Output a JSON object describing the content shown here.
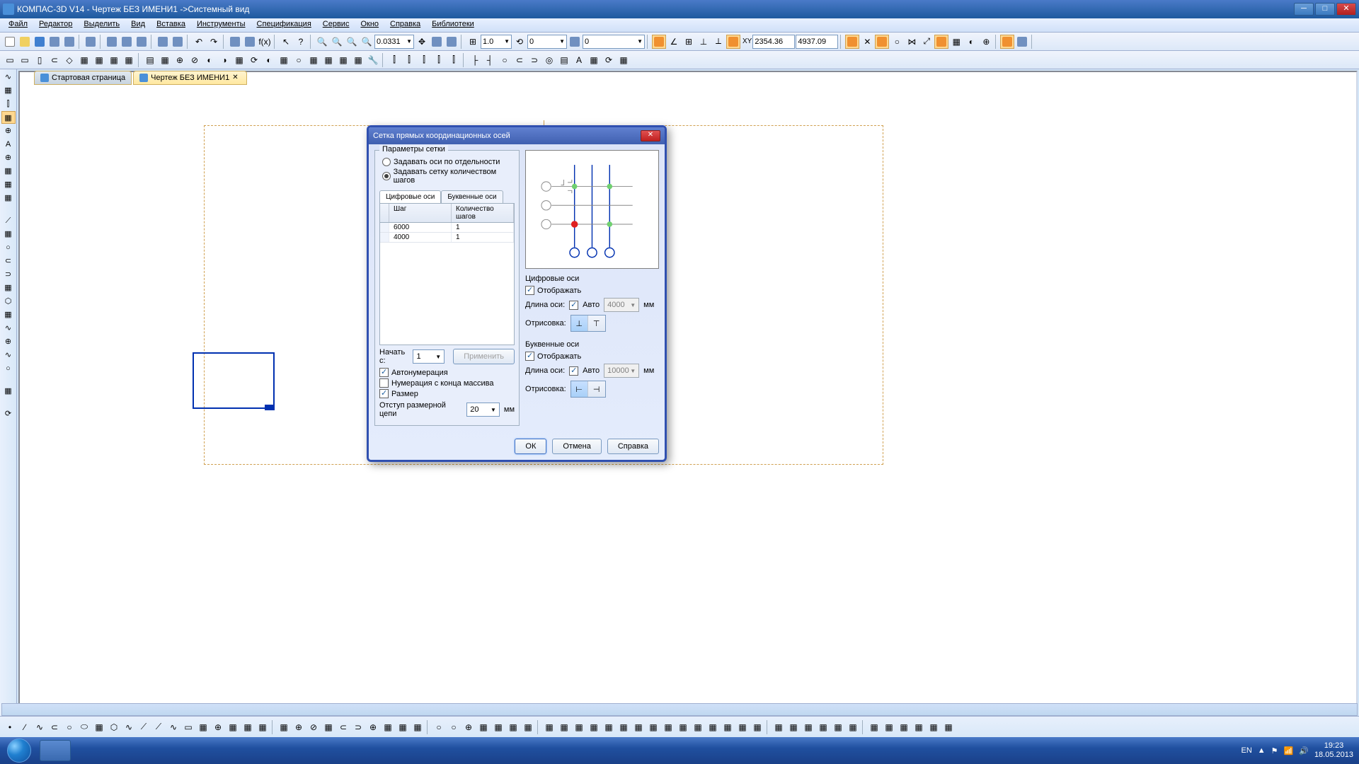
{
  "app": {
    "title": "КОМПАС-3D V14 - Чертеж БЕЗ ИМЕНИ1 ->Системный вид"
  },
  "menu": {
    "items": [
      "Файл",
      "Редактор",
      "Выделить",
      "Вид",
      "Вставка",
      "Инструменты",
      "Спецификация",
      "Сервис",
      "Окно",
      "Справка",
      "Библиотеки"
    ]
  },
  "toolbar1": {
    "zoom_value": "0.0331",
    "scale_value": "1.0",
    "coord1": "0",
    "coord2": "0",
    "x_val": "2354.36",
    "y_val": "4937.09"
  },
  "tabs": {
    "start": "Стартовая страница",
    "doc": "Чертеж БЕЗ ИМЕНИ1"
  },
  "dialog": {
    "title": "Сетка прямых координационных осей",
    "group_title": "Параметры сетки",
    "radio1": "Задавать оси по отдельности",
    "radio2": "Задавать сетку количеством шагов",
    "tab_digital": "Цифровые оси",
    "tab_letter": "Буквенные оси",
    "col_step": "Шаг",
    "col_count": "Количество шагов",
    "rows": [
      {
        "step": "6000",
        "count": "1"
      },
      {
        "step": "4000",
        "count": "1"
      }
    ],
    "start_from": "Начать с:",
    "start_value": "1",
    "apply": "Применить",
    "chk_autonum": "Автонумерация",
    "chk_endnum": "Нумерация с конца массива",
    "chk_size": "Размер",
    "dim_offset": "Отступ размерной цепи",
    "dim_offset_val": "20",
    "mm": "мм",
    "digital_axes": "Цифровые оси",
    "letter_axes": "Буквенные оси",
    "show": "Отображать",
    "axis_len": "Длина оси:",
    "auto": "Авто",
    "len_digital": "4000",
    "len_letter": "10000",
    "rendering": "Отрисовка:",
    "ok": "ОК",
    "cancel": "Отмена",
    "help": "Справка"
  },
  "tray": {
    "lang": "EN",
    "time": "19:23",
    "date": "18.05.2013"
  }
}
